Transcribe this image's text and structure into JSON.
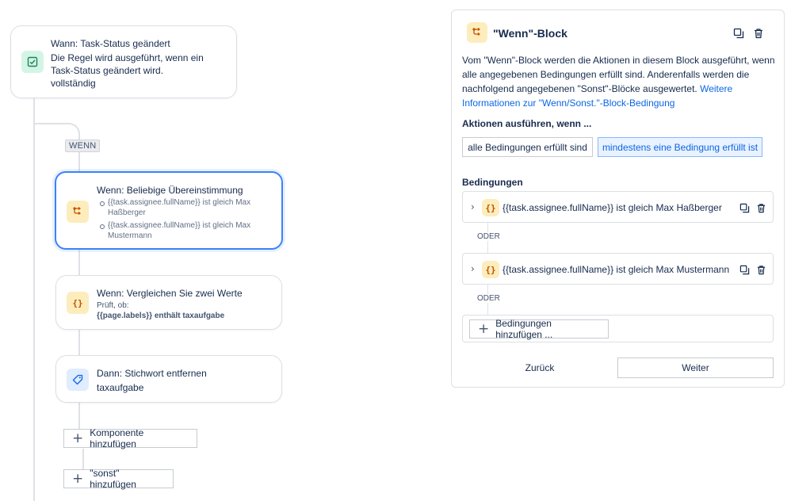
{
  "trigger": {
    "title": "Wann: Task-Status geändert",
    "description": "Die Regel wird ausgeführt, wenn ein Task-Status geändert wird.",
    "value": "vollständig"
  },
  "branch_label": "WENN",
  "if_block": {
    "title": "Wenn: Beliebige Übereinstimmung",
    "conditions": [
      "{{task.assignee.fullName}} ist gleich Max Haßberger",
      "{{task.assignee.fullName}} ist gleich Max Mustermann"
    ]
  },
  "compare_block": {
    "title": "Wenn: Vergleichen Sie zwei Werte",
    "check_label": "Prüft, ob:",
    "check_value": "{{page.labels}} enthält taxaufgabe"
  },
  "action_block": {
    "title": "Dann: Stichwort entfernen",
    "value": "taxaufgabe"
  },
  "add_component_label": "Komponente hinzufügen",
  "add_else_label": "\"sonst\" hinzufügen",
  "panel": {
    "title": "\"Wenn\"-Block",
    "description": "Vom \"Wenn\"-Block werden die Aktionen in diesem Block ausgeführt, wenn alle angegebenen Bedingungen erfüllt sind. Anderenfalls werden die nachfolgend angegebenen \"Sonst\"-Blöcke ausgewertet.",
    "link_text": "Weitere Informationen zur \"Wenn/Sonst.\"-Block-Bedingung",
    "run_label": "Aktionen ausführen, wenn ...",
    "option_all": "alle Bedingungen erfüllt sind",
    "option_any": "mindestens eine Bedingung erfüllt ist",
    "selected_option": "mindestens eine Bedingung erfüllt ist",
    "conditions_label": "Bedingungen",
    "conditions": [
      "{{task.assignee.fullName}} ist gleich Max Haßberger",
      "{{task.assignee.fullName}} ist gleich Max Mustermann"
    ],
    "or_label": "ODER",
    "add_conditions_label": "Bedingungen hinzufügen ...",
    "back_label": "Zurück",
    "next_label": "Weiter"
  },
  "colors": {
    "accent": "#3b82f6",
    "link": "#0c66e4",
    "selected_bg": "#e9f2ff",
    "icon_green": "#d3f5e6",
    "icon_yellow": "#fdedbc",
    "icon_blue": "#e0ecff"
  }
}
